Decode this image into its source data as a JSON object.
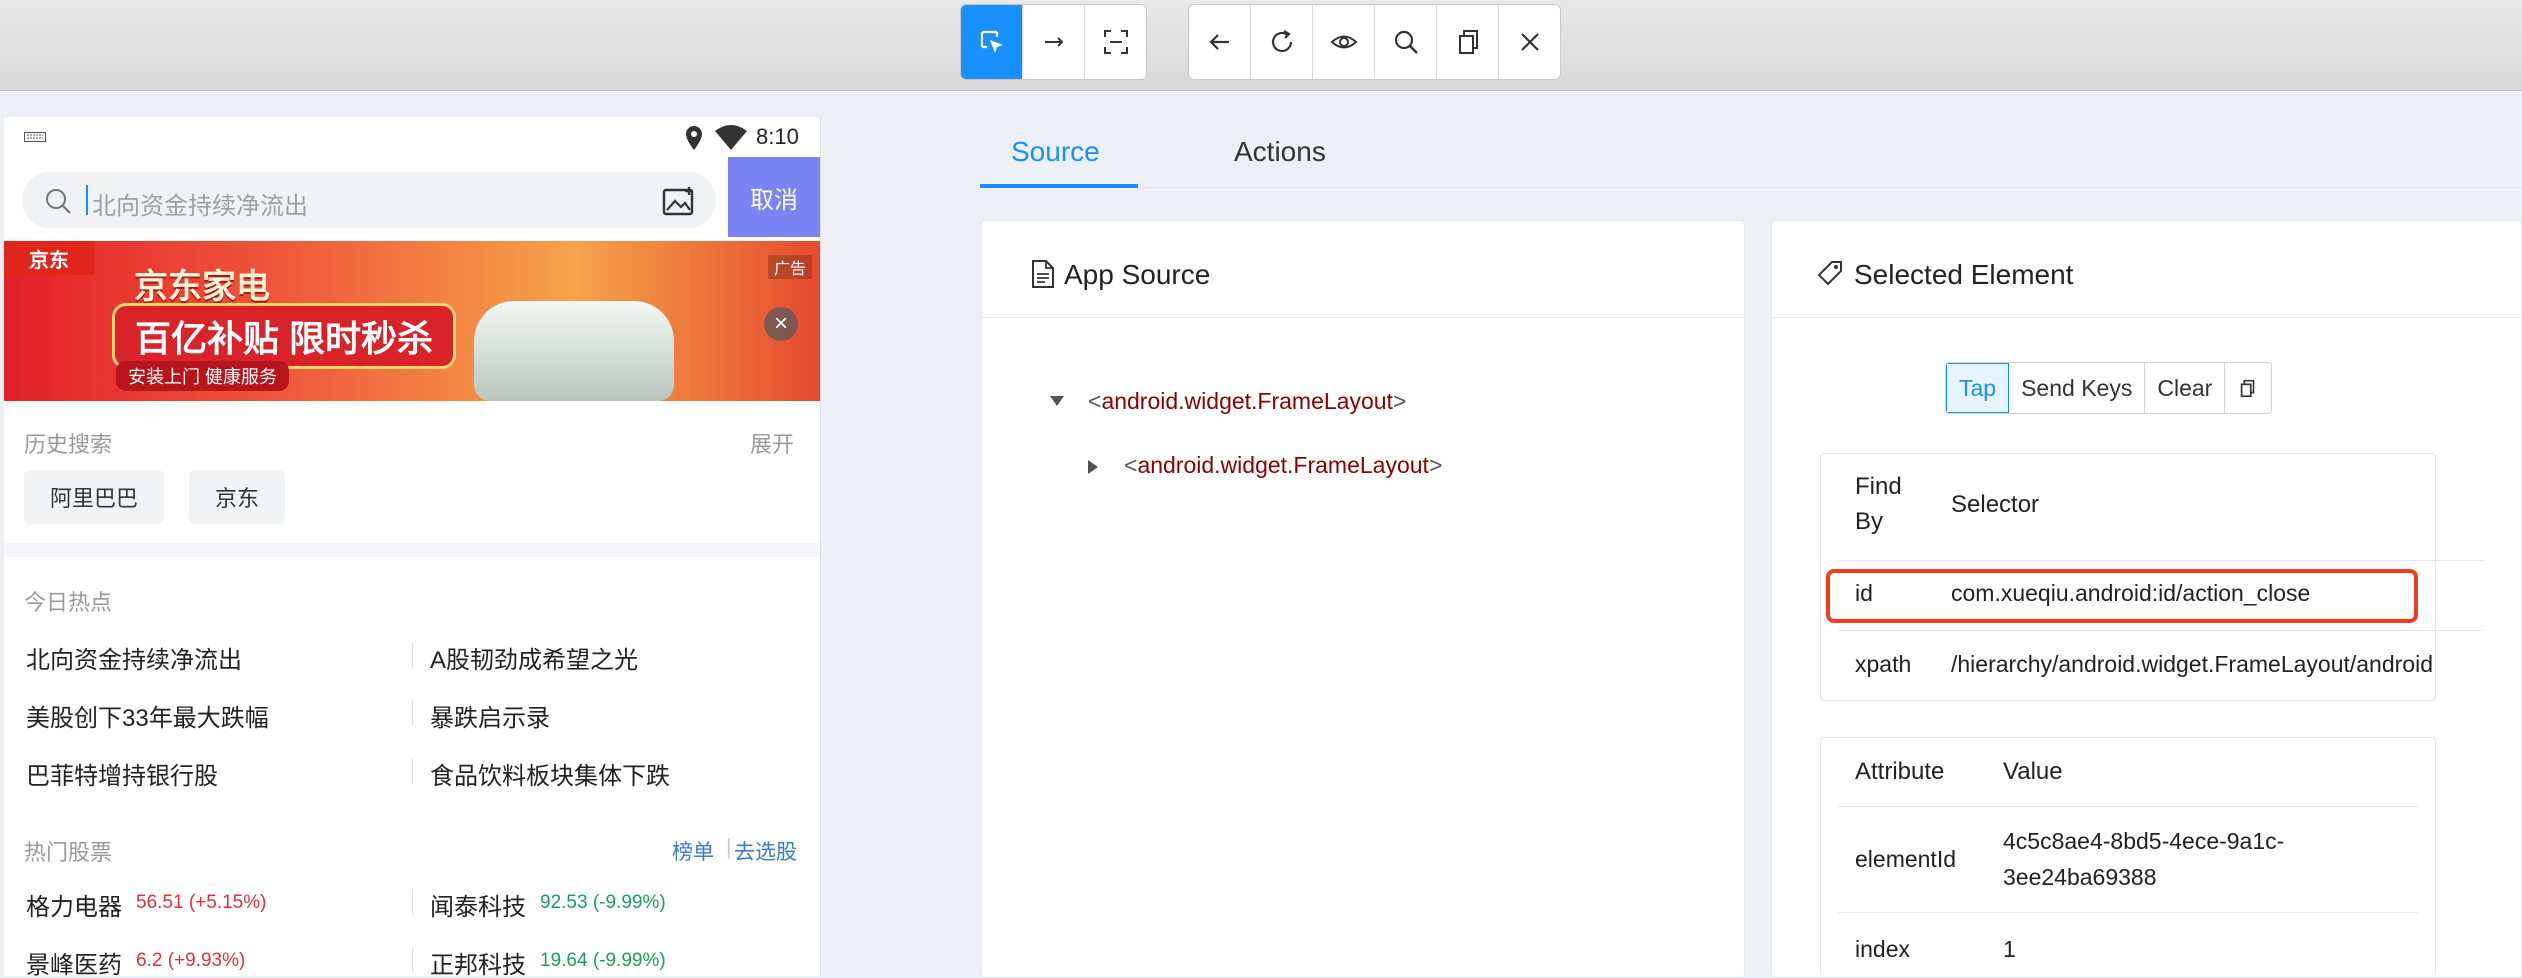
{
  "toolbar": {
    "group1": [
      {
        "icon": "select-element-icon",
        "active": true
      },
      {
        "icon": "swipe-arrow-icon",
        "active": false
      },
      {
        "icon": "tap-by-coordinates-icon",
        "active": false
      }
    ],
    "group2": [
      {
        "icon": "back-arrow-icon"
      },
      {
        "icon": "refresh-icon"
      },
      {
        "icon": "eye-icon"
      },
      {
        "icon": "search-icon"
      },
      {
        "icon": "copy-icon"
      },
      {
        "icon": "close-icon"
      }
    ]
  },
  "phone": {
    "time": "8:10",
    "search_placeholder": "北向资金持续净流出",
    "cancel_label": "取消",
    "banner": {
      "brand": "京东",
      "title": "京东家电",
      "slogan": "百亿补贴 限时秒杀",
      "sub": "安装上门 健康服务",
      "ad_label": "广告"
    },
    "history": {
      "label": "历史搜索",
      "expand": "展开",
      "chips": [
        "阿里巴巴",
        "京东"
      ]
    },
    "hot": {
      "label": "今日热点",
      "items": [
        "北向资金持续净流出",
        "A股韧劲成希望之光",
        "美股创下33年最大跌幅",
        "暴跌启示录",
        "巴菲特增持银行股",
        "食品饮料板块集体下跌"
      ]
    },
    "stocks": {
      "label": "热门股票",
      "link_rank": "榜单",
      "link_pick": "去选股",
      "items": [
        {
          "name": "格力电器",
          "quote": "56.51 (+5.15%)",
          "dir": "up"
        },
        {
          "name": "闻泰科技",
          "quote": "92.53 (-9.99%)",
          "dir": "down"
        },
        {
          "name": "景峰医药",
          "quote": "6.2 (+9.93%)",
          "dir": "up"
        },
        {
          "name": "正邦科技",
          "quote": "19.64 (-9.99%)",
          "dir": "down"
        }
      ]
    }
  },
  "tabs": {
    "source": "Source",
    "actions": "Actions"
  },
  "app_source": {
    "title": "App Source",
    "nodes": [
      {
        "open": "<",
        "name": "android.widget.FrameLayout",
        "close": ">"
      },
      {
        "open": "<",
        "name": "android.widget.FrameLayout",
        "close": ">"
      }
    ]
  },
  "selected": {
    "title": "Selected Element",
    "buttons": {
      "tap": "Tap",
      "send_keys": "Send Keys",
      "clear": "Clear"
    },
    "selector_table": {
      "h_find_by_1": "Find",
      "h_find_by_2": "By",
      "h_selector": "Selector",
      "rows": [
        {
          "find_by": "id",
          "selector": "com.xueqiu.android:id/action_close"
        },
        {
          "find_by": "xpath",
          "selector": "/hierarchy/android.widget.FrameLayout/android"
        }
      ]
    },
    "attr_table": {
      "h_attribute": "Attribute",
      "h_value": "Value",
      "rows": [
        {
          "attribute": "elementId",
          "value_1": "4c5c8ae4-8bd5-4ece-9a1c-",
          "value_2": "3ee24ba69388"
        },
        {
          "attribute": "index",
          "value_1": "1"
        }
      ]
    }
  },
  "colors": {
    "accent": "#1890ff",
    "highlight": "#f23b1f",
    "up": "#e0303a",
    "down": "#1aa05a"
  }
}
